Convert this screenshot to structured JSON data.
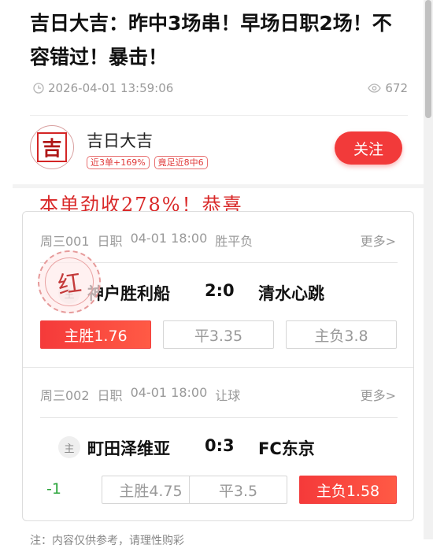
{
  "article": {
    "title": "吉日大吉：昨中3场串！早场日职2场！不容错过！暴击！",
    "datetime": "2026-04-01 13:59:06",
    "views": "672"
  },
  "author": {
    "avatar_char": "吉",
    "name": "吉日大吉",
    "tags": [
      "近3单+169%",
      "竟足近8中6"
    ],
    "follow_label": "关注"
  },
  "promo": "本单劲收278%！恭喜",
  "stamp_text": "红",
  "matches": [
    {
      "code": "周三001",
      "league": "日职",
      "time": "04-01 18:00",
      "play": "胜平负",
      "more": "更多>",
      "host_badge": "主",
      "home": "神户胜利船",
      "score": "2:0",
      "away": "清水心跳",
      "handicap": "",
      "odds": [
        "主胜1.76",
        "平3.35",
        "主负3.8"
      ],
      "selected_index": 0
    },
    {
      "code": "周三002",
      "league": "日职",
      "time": "04-01 18:00",
      "play": "让球",
      "more": "更多>",
      "host_badge": "主",
      "home": "町田泽维亚",
      "score": "0:3",
      "away": "FC东京",
      "handicap": "-1",
      "odds": [
        "主胜4.75",
        "平3.5",
        "主负1.58"
      ],
      "selected_index": 2
    }
  ],
  "footnote": "注：内容仅供参考，请理性购彩"
}
